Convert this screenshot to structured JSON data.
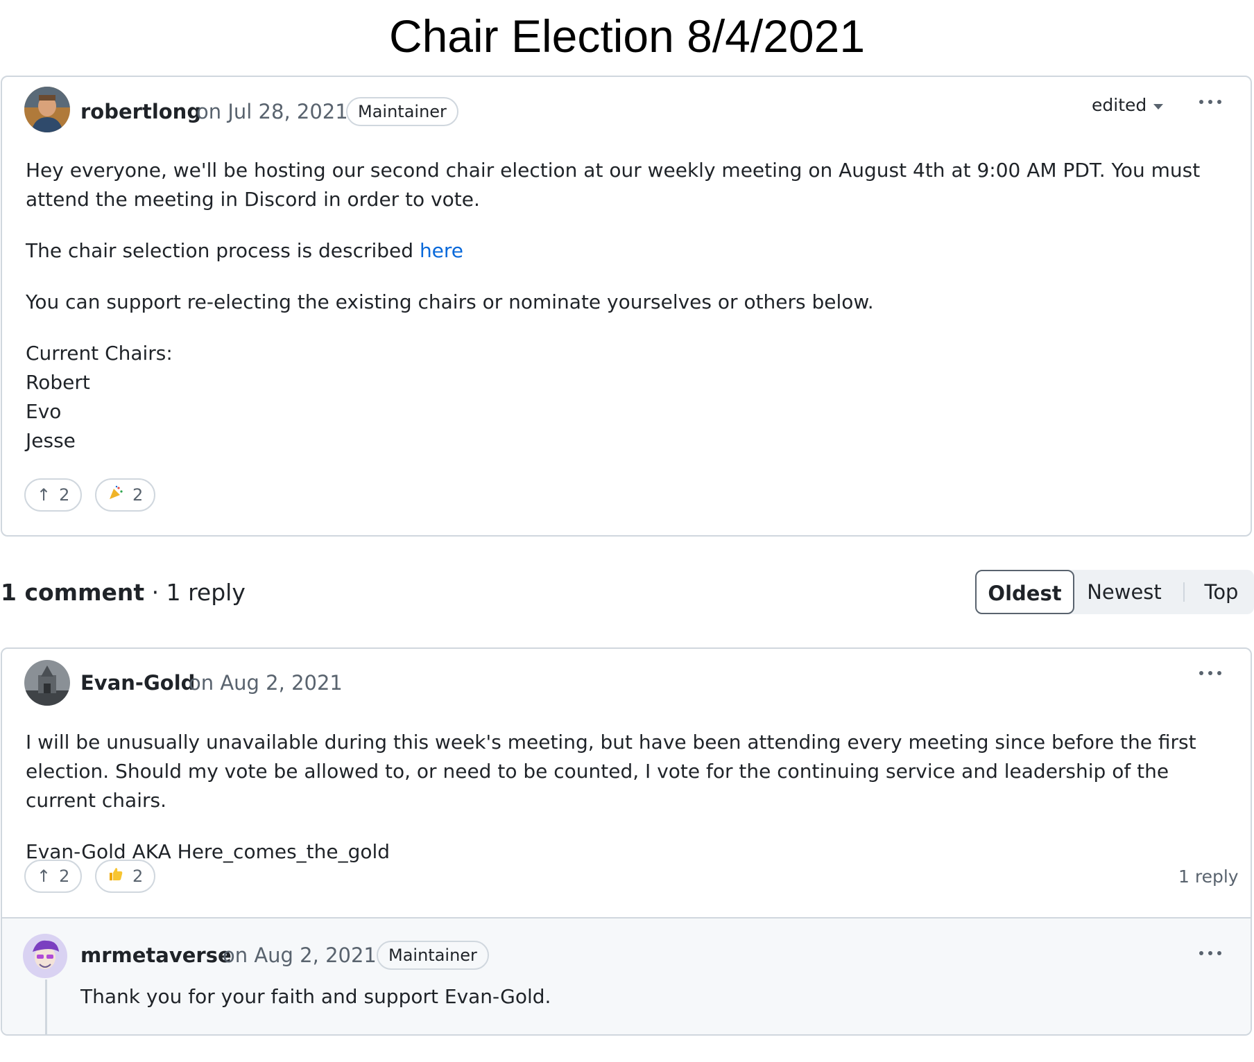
{
  "page_title": "Chair Election 8/4/2021",
  "post": {
    "author": "robertlong",
    "date": "on Jul 28, 2021",
    "role": "Maintainer",
    "edited_label": "edited",
    "paragraph1": "Hey everyone, we'll be hosting our second chair election at our weekly meeting on August 4th at 9:00 AM PDT. You must attend the meeting in Discord in order to vote.",
    "paragraph2_prefix": "The chair selection process is described ",
    "paragraph2_link": "here",
    "paragraph3": "You can support re-electing the existing chairs or nominate yourselves or others below.",
    "chairs_heading": "Current Chairs:",
    "chairs": [
      "Robert",
      "Evo",
      "Jesse"
    ],
    "upvote_count": "2",
    "tada_count": "2"
  },
  "comments_header": {
    "comment_count": "1 comment",
    "separator": " · ",
    "reply_count": "1 reply"
  },
  "sort": {
    "options": [
      "Oldest",
      "Newest",
      "Top"
    ],
    "selected": "Oldest"
  },
  "comment": {
    "author": "Evan-Gold",
    "date": "on Aug 2, 2021",
    "paragraph1": "I will be unusually unavailable during this week's meeting, but have been attending every meeting since before the first election. Should my vote be allowed to, or need to be counted, I vote for the continuing service and leadership of the current chairs.",
    "paragraph2": "Evan-Gold AKA Here_comes_the_gold",
    "upvote_count": "2",
    "thumbsup_count": "2",
    "reply_link": "1 reply"
  },
  "reply": {
    "author": "mrmetaverse",
    "date": "on Aug 2, 2021",
    "role": "Maintainer",
    "text": "Thank you for your faith and support Evan-Gold."
  },
  "colors": {
    "link": "#0969da",
    "border": "#d0d7de",
    "muted": "#59636e",
    "reply_bg": "#f6f8fa"
  },
  "icons": [
    "arrow-up-icon",
    "party-popper-icon",
    "thumbs-up-icon",
    "kebab-icon",
    "caret-down-icon"
  ]
}
